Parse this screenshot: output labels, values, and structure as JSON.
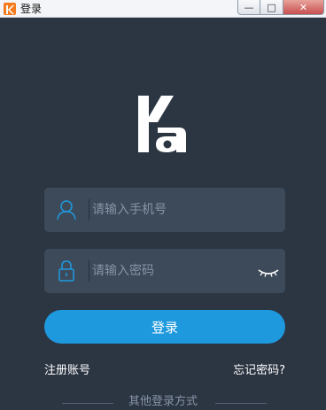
{
  "window": {
    "title": "登录",
    "minimize_glyph": "—",
    "maximize_glyph": "□",
    "close_glyph": "✕"
  },
  "logo": {
    "icon": "ka-logo"
  },
  "form": {
    "phone_placeholder": "请输入手机号",
    "phone_value": "",
    "password_placeholder": "请输入密码",
    "password_value": "",
    "login_label": "登录"
  },
  "links": {
    "register": "注册账号",
    "forgot": "忘记密码?"
  },
  "other_login": {
    "label": "其他登录方式"
  },
  "colors": {
    "background": "#2c3542",
    "field_bg": "#3d4a5a",
    "accent": "#1e99de",
    "app_icon": "#f47b20"
  }
}
